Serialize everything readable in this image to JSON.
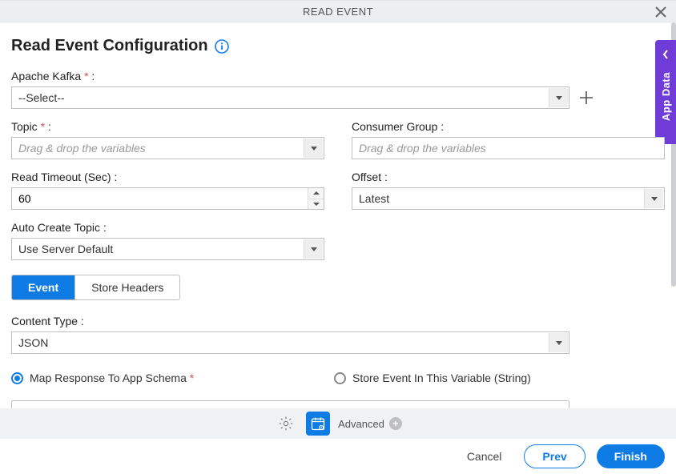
{
  "header": {
    "title": "READ EVENT"
  },
  "page": {
    "title": "Read Event Configuration"
  },
  "sidebar": {
    "label": "App Data"
  },
  "fields": {
    "kafka": {
      "label": "Apache Kafka",
      "required": "*",
      "colon": " :",
      "value": "--Select--"
    },
    "topic": {
      "label": "Topic",
      "required": "*",
      "colon": " :",
      "placeholder": "Drag & drop the variables"
    },
    "consumerGroup": {
      "label": "Consumer Group :",
      "placeholder": "Drag & drop the variables"
    },
    "readTimeout": {
      "label": "Read Timeout (Sec) :",
      "value": "60"
    },
    "offset": {
      "label": "Offset :",
      "value": "Latest"
    },
    "autoCreate": {
      "label": "Auto Create Topic :",
      "value": "Use Server Default"
    },
    "contentType": {
      "label": "Content Type :",
      "value": "JSON"
    }
  },
  "tabs": {
    "event": "Event",
    "storeHeaders": "Store Headers"
  },
  "radios": {
    "mapSchema": {
      "label": "Map Response To App Schema",
      "required": "*"
    },
    "storeVar": {
      "label": "Store Event In This Variable (String)"
    }
  },
  "toolbar": {
    "advanced": "Advanced"
  },
  "footer": {
    "cancel": "Cancel",
    "prev": "Prev",
    "finish": "Finish"
  }
}
